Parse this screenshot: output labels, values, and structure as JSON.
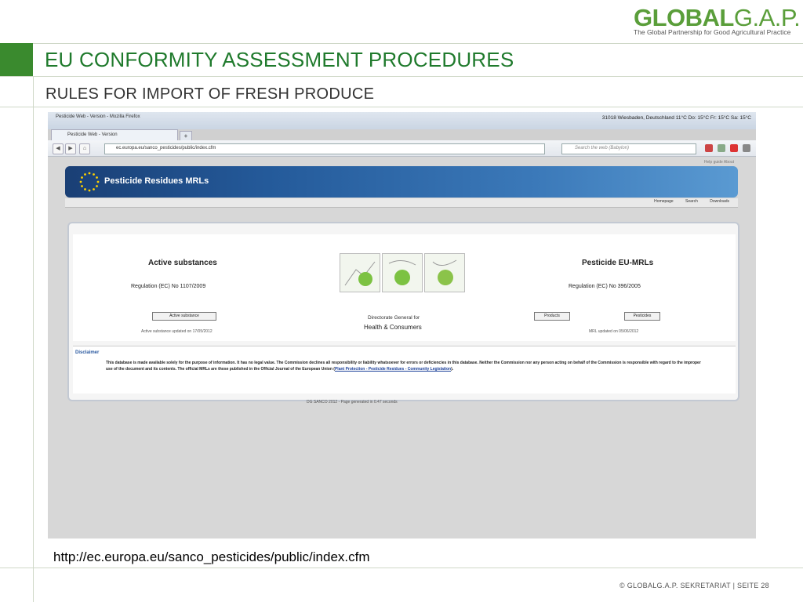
{
  "logo": {
    "brand_bold": "GLOBAL",
    "brand_light": "G.A.P.",
    "tagline": "The Global Partnership for Good Agricultural Practice"
  },
  "slide": {
    "title": "EU CONFORMITY ASSESSMENT PROCEDURES",
    "subtitle": "RULES FOR IMPORT OF FRESH PRODUCE",
    "url_caption": "http://ec.europa.eu/sanco_pesticides/public/index.cfm",
    "footer": "© GLOBALG.A.P. SEKRETARIAT | SEITE 28"
  },
  "browser": {
    "window_title": "Pesticide Web - Version - Mozilla Firefox",
    "tab_label": "Pesticide Web - Version",
    "url": "ec.europa.eu/sanco_pesticides/public/index.cfm",
    "search_placeholder": "Search the web (Babylon)",
    "weather": "31018 Wiesbaden, Deutschland 11°C  Do: 15°C  Fr: 15°C  Sa: 15°C",
    "accent": "#245a9a"
  },
  "site": {
    "top_links": "Help guide   About",
    "banner_title": "Pesticide Residues MRLs",
    "subnav": "Homepage Search Downloads",
    "left": {
      "heading": "Active substances",
      "regulation": "Regulation (EC) No 1107/2009",
      "button": "Active substance",
      "updated": "Active substance updated on 17/05/2012"
    },
    "right": {
      "heading": "Pesticide EU-MRLs",
      "regulation": "Regulation (EC) No 396/2005",
      "button_products": "Products",
      "button_pesticides": "Pesticides",
      "updated": "MRL updated on 05/06/2012"
    },
    "center": {
      "line1": "Directorate General for",
      "line2": "Health & Consumers"
    },
    "disclaimer": {
      "title": "Disclaimer",
      "text": "This database is made available solely for the purpose of information. It has no legal value. The Commission declines all responsibility or liability whatsoever for errors or deficiencies in this database. Neither the Commission nor any person acting on behalf of the Commission is responsible with regard to the improper use of the document and its contents. The official MRLs are those published in the Official Journal of the European Union (",
      "link": "Plant Protection - Pesticide Residues - Community Legislation",
      "end": ")."
    },
    "footer": "DG SANCO 2012 - Page generated in 0.47 seconds"
  }
}
